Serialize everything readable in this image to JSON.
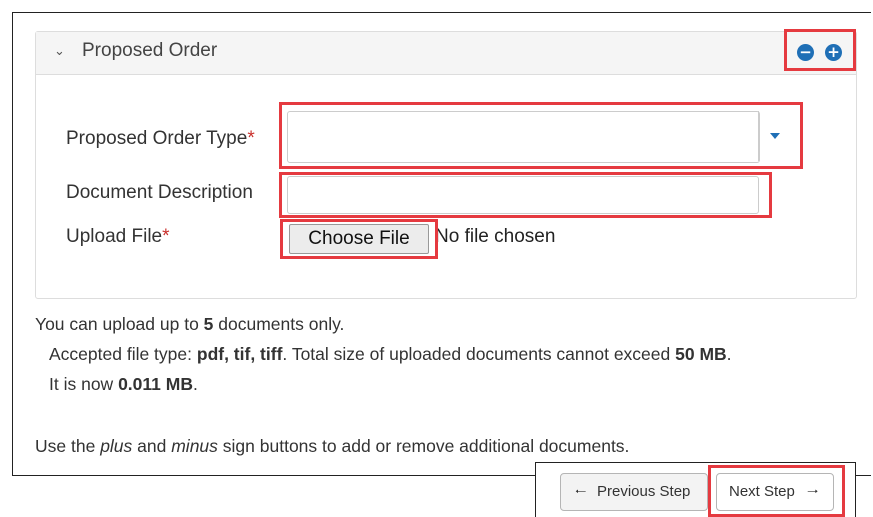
{
  "panel": {
    "title": "Proposed Order",
    "collapse_icon": "chevron-down-icon",
    "buttons": {
      "minus_icon": "minus-circle-icon",
      "plus_icon": "plus-circle-icon",
      "minus_glyph": "−",
      "plus_glyph": "+"
    }
  },
  "form": {
    "order_type_label": "Proposed Order Type",
    "doc_desc_label": "Document Description",
    "upload_label": "Upload File",
    "required_mark": "*",
    "order_type_value": "",
    "doc_desc_value": "",
    "choose_file_label": "Choose File",
    "no_file_text": "No file chosen"
  },
  "info": {
    "line1_pre": "You can upload up to ",
    "line1_count": "5",
    "line1_post": " documents only.",
    "line2_pre": "Accepted file type: ",
    "line2_types": "pdf, tif, tiff",
    "line2_mid": ". Total size of uploaded documents cannot exceed ",
    "line2_max": "50 MB",
    "line2_post": ".",
    "line3_pre": "It is now ",
    "line3_size": "0.011 MB",
    "line3_post": ".",
    "line4_pre": "Use the ",
    "line4_plus": "plus",
    "line4_and": " and ",
    "line4_minus": "minus",
    "line4_post": " sign buttons to add or remove additional documents."
  },
  "nav": {
    "previous_label": "Previous Step",
    "next_label": "Next Step",
    "previous_icon": "arrow-left-icon",
    "next_icon": "arrow-right-icon"
  },
  "colors": {
    "highlight": "#e53a40",
    "accent": "#1f6fb6",
    "required": "#c9302c"
  }
}
